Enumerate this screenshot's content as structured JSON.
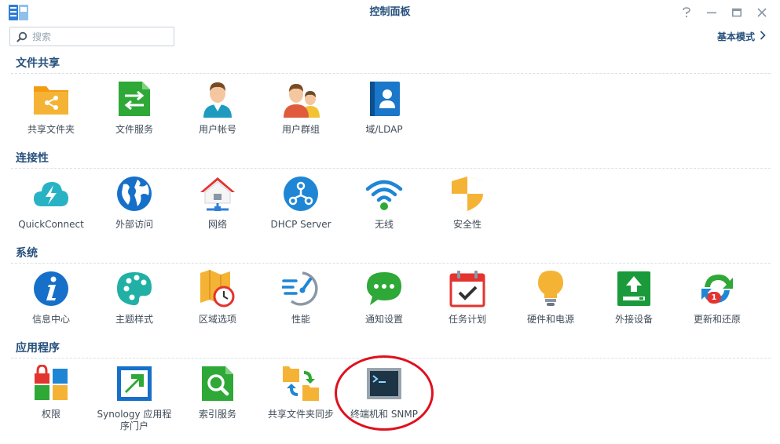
{
  "window": {
    "title": "控制面板"
  },
  "search": {
    "placeholder": "搜索"
  },
  "mode_link": {
    "label": "基本模式"
  },
  "sections": [
    {
      "title": "文件共享",
      "items": [
        {
          "label": "共享文件夹",
          "icon": "shared-folder-icon"
        },
        {
          "label": "文件服务",
          "icon": "file-services-icon"
        },
        {
          "label": "用户帐号",
          "icon": "user-icon"
        },
        {
          "label": "用户群组",
          "icon": "group-icon"
        },
        {
          "label": "域/LDAP",
          "icon": "ldap-icon"
        }
      ]
    },
    {
      "title": "连接性",
      "items": [
        {
          "label": "QuickConnect",
          "icon": "quickconnect-icon"
        },
        {
          "label": "外部访问",
          "icon": "globe-icon"
        },
        {
          "label": "网络",
          "icon": "network-home-icon"
        },
        {
          "label": "DHCP Server",
          "icon": "dhcp-icon"
        },
        {
          "label": "无线",
          "icon": "wifi-icon"
        },
        {
          "label": "安全性",
          "icon": "shield-icon"
        }
      ]
    },
    {
      "title": "系统",
      "items": [
        {
          "label": "信息中心",
          "icon": "info-icon"
        },
        {
          "label": "主题样式",
          "icon": "palette-icon"
        },
        {
          "label": "区域选项",
          "icon": "region-map-icon"
        },
        {
          "label": "性能",
          "icon": "speedometer-icon"
        },
        {
          "label": "通知设置",
          "icon": "chat-bubble-icon"
        },
        {
          "label": "任务计划",
          "icon": "calendar-check-icon"
        },
        {
          "label": "硬件和电源",
          "icon": "lightbulb-icon"
        },
        {
          "label": "外接设备",
          "icon": "external-device-icon"
        },
        {
          "label": "更新和还原",
          "icon": "update-restore-icon",
          "badge": "1"
        }
      ]
    },
    {
      "title": "应用程序",
      "items": [
        {
          "label": "权限",
          "icon": "privileges-icon"
        },
        {
          "label": "Synology 应用程序门户",
          "icon": "app-portal-icon"
        },
        {
          "label": "索引服务",
          "icon": "index-search-icon"
        },
        {
          "label": "共享文件夹同步",
          "icon": "folder-sync-icon"
        },
        {
          "label": "终端机和 SNMP",
          "icon": "terminal-icon"
        }
      ]
    }
  ],
  "colors": {
    "accent": "#254f7b",
    "highlight": "#e0101e"
  }
}
